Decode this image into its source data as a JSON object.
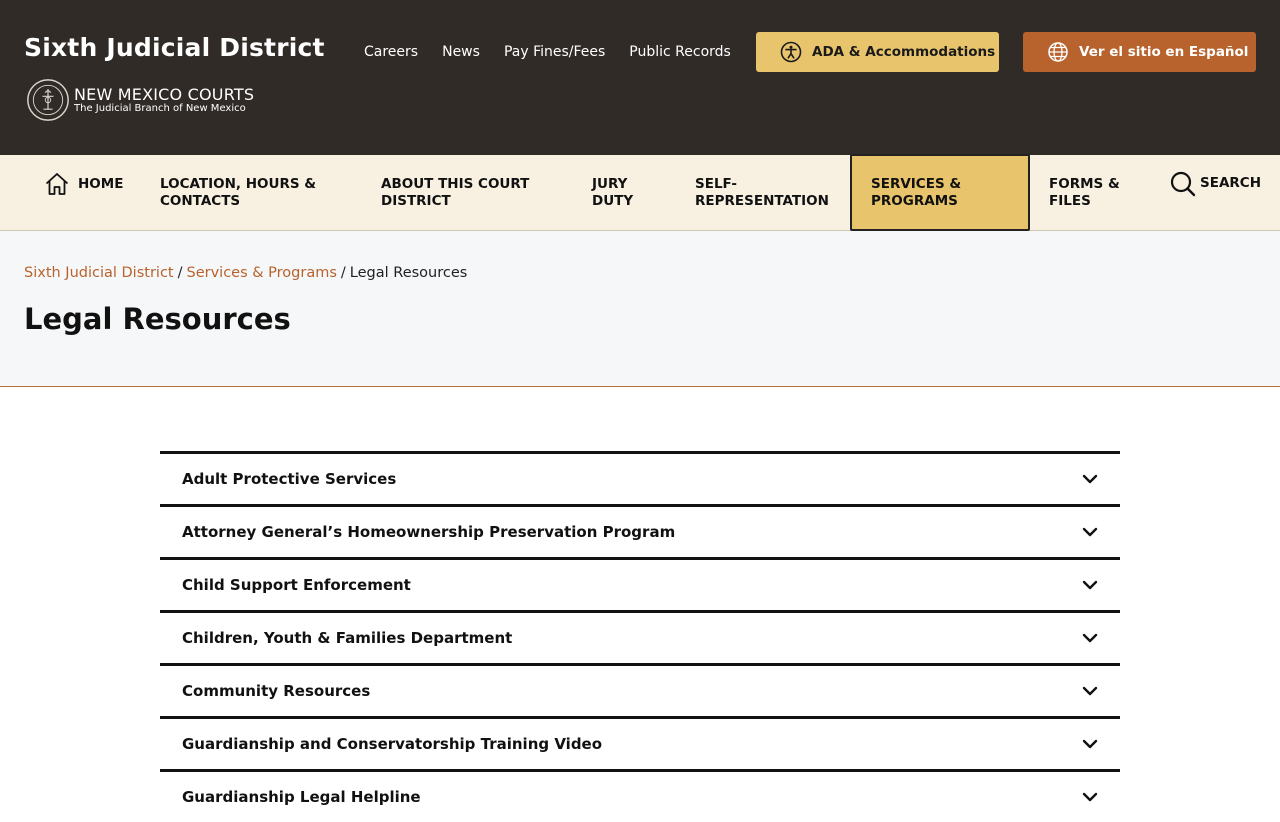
{
  "header": {
    "site_title": "Sixth Judicial District",
    "logo_line1": "NEW MEXICO COURTS",
    "logo_line2": "The Judicial Branch of New Mexico",
    "utility_links": [
      "Careers",
      "News",
      "Pay Fines/Fees",
      "Public Records"
    ],
    "ada_button": "ADA & Accommodations",
    "spanish_button": "Ver el sitio en Español",
    "colors": {
      "background": "#312b27",
      "ada": "#e8c46c",
      "spanish": "#b8632d"
    }
  },
  "nav": {
    "home": "HOME",
    "items": [
      {
        "line1": "LOCATION, HOURS &",
        "line2": "CONTACTS"
      },
      {
        "line1": "ABOUT THIS COURT",
        "line2": "DISTRICT"
      },
      {
        "line1": "JURY",
        "line2": "DUTY"
      },
      {
        "line1": "SELF-",
        "line2": "REPRESENTATION"
      },
      {
        "line1": "SERVICES &",
        "line2": "PROGRAMS"
      },
      {
        "line1": "FORMS &",
        "line2": "FILES"
      }
    ],
    "active_index": 4,
    "search": "SEARCH"
  },
  "breadcrumb": {
    "items": [
      "Sixth Judicial District",
      "Services & Programs"
    ],
    "current": "Legal Resources",
    "separator": "/"
  },
  "page_title": "Legal Resources",
  "accordion": [
    "Adult Protective Services",
    "Attorney General’s Homeownership Preservation Program",
    "Child Support Enforcement",
    "Children, Youth & Families Department",
    "Community Resources",
    "Guardianship and Conservatorship Training Video",
    "Guardianship Legal Helpline"
  ],
  "icons": {
    "ada": "accessibility-icon",
    "spanish": "globe-icon",
    "home": "home-icon",
    "search": "search-icon",
    "accordion": "chevron-down-icon",
    "seal": "court-seal-icon"
  }
}
